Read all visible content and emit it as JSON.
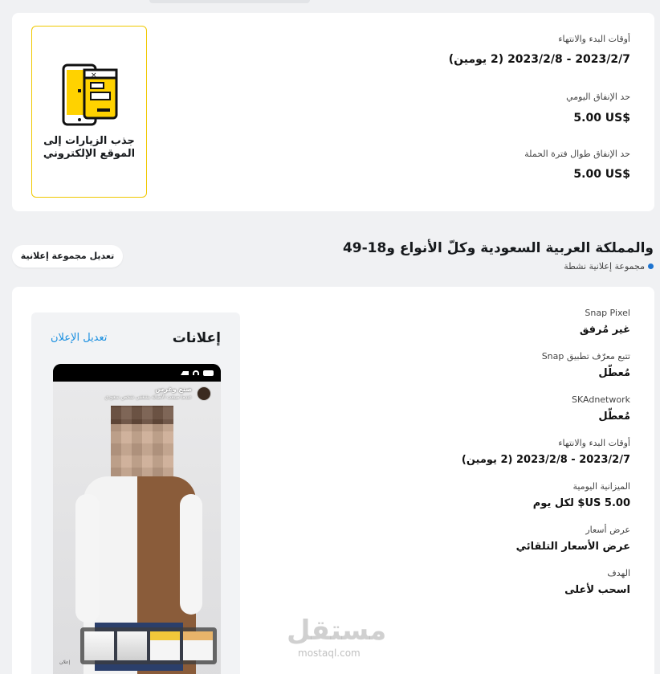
{
  "campaign": {
    "objective_card_label": "جذب الزيارات إلى الموقع الإلكتروني",
    "start_end_label": "أوقات البدء والانتهاء",
    "start_end_value": "2023/2/7 - 2023/2/8 (2 يومين)",
    "daily_cap_label": "حد الإنفاق اليومي",
    "daily_cap_value": "5.00 US$",
    "lifetime_cap_label": "حد الإنفاق طوال فترة الحملة",
    "lifetime_cap_value": "5.00 US$"
  },
  "adset": {
    "title": "والمملكة العربية السعودية وكلّ الأنواع و18-49",
    "status": "مجموعة إعلانية نشطة",
    "edit_button": "تعديل مجموعة إعلانية",
    "colors": {
      "status_dot": "#1e74d0",
      "accent": "#ffd200"
    },
    "details": [
      {
        "label": "Snap Pixel",
        "value": "غير مُرفق"
      },
      {
        "label": "تتبع معرّف تطبيق Snap",
        "value": "مُعطّل"
      },
      {
        "label": "SKAdnetwork",
        "value": "مُعطّل"
      },
      {
        "label": "أوقات البدء والانتهاء",
        "value": "2023/2/7 - 2023/2/8 (2 يومين)"
      },
      {
        "label": "الميزانية اليومية",
        "value": "5.00 US$ لكل يوم"
      },
      {
        "label": "عرض أسعار",
        "value": "عرض الأسعار التلقائي"
      },
      {
        "label": "الهدف",
        "value": "اسحب لأعلى"
      }
    ]
  },
  "ads": {
    "title": "إعلانات",
    "edit_link": "تعديل الإعلان",
    "brand_name": "صنع وغرس",
    "brand_tagline": "عندما صنعت الأصالة بشغفي شخص سعودي",
    "bottom_label": "إعلان"
  },
  "watermark": {
    "logo": "مستقل",
    "url": "mostaql.com"
  }
}
